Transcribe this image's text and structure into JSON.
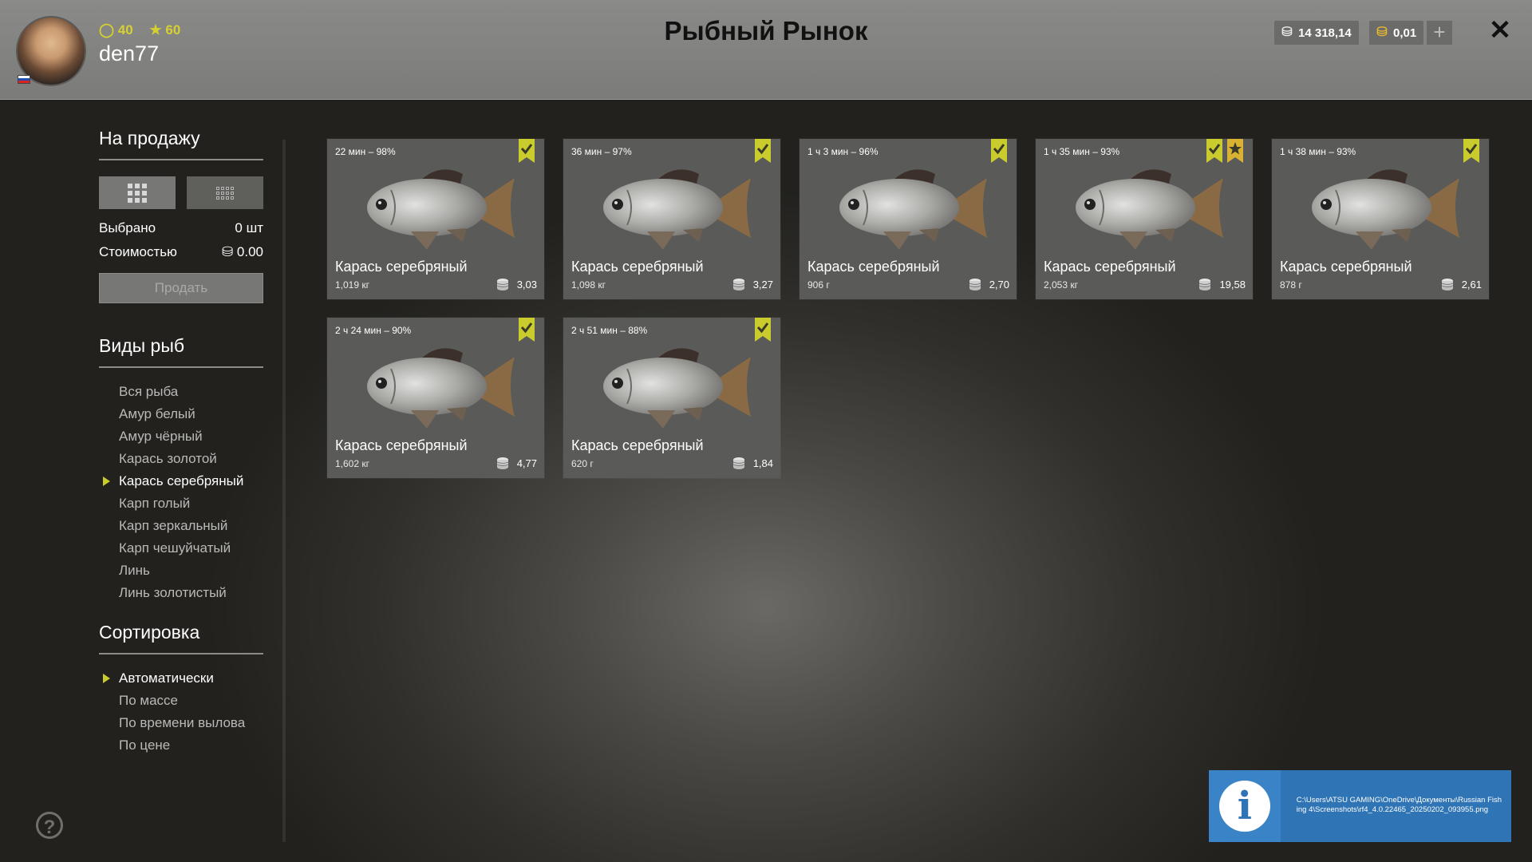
{
  "header": {
    "title": "Рыбный Рынок",
    "level": "40",
    "rank": "60",
    "username": "den77",
    "silver": "14 318,14",
    "gold": "0,01",
    "plus_label": "+",
    "close_label": "✕"
  },
  "sidebar": {
    "for_sale_title": "На продажу",
    "selected_label": "Выбрано",
    "selected_value": "0 шт",
    "cost_label": "Стоимостью",
    "cost_value": "0.00",
    "sell_button": "Продать",
    "species_title": "Виды рыб",
    "species": [
      {
        "label": "Вся рыба"
      },
      {
        "label": "Амур белый"
      },
      {
        "label": "Амур чёрный"
      },
      {
        "label": "Карась золотой"
      },
      {
        "label": "Карась серебряный",
        "active": true
      },
      {
        "label": "Карп голый"
      },
      {
        "label": "Карп зеркальный"
      },
      {
        "label": "Карп чешуйчатый"
      },
      {
        "label": "Линь"
      },
      {
        "label": "Линь золотистый"
      }
    ],
    "sort_title": "Сортировка",
    "sort": [
      {
        "label": "Автоматически",
        "active": true
      },
      {
        "label": "По массе"
      },
      {
        "label": "По времени вылова"
      },
      {
        "label": "По цене"
      }
    ]
  },
  "cards": [
    {
      "time": "22 мин – 98%",
      "name": "Карась серебряный",
      "weight": "1,019 кг",
      "price": "3,03",
      "star": false
    },
    {
      "time": "36 мин – 97%",
      "name": "Карась серебряный",
      "weight": "1,098 кг",
      "price": "3,27",
      "star": false
    },
    {
      "time": "1 ч 3 мин – 96%",
      "name": "Карась серебряный",
      "weight": "906 г",
      "price": "2,70",
      "star": false
    },
    {
      "time": "1 ч 35 мин – 93%",
      "name": "Карась серебряный",
      "weight": "2,053 кг",
      "price": "19,58",
      "star": true
    },
    {
      "time": "1 ч 38 мин – 93%",
      "name": "Карась серебряный",
      "weight": "878 г",
      "price": "2,61",
      "star": false
    },
    {
      "time": "2 ч 24 мин – 90%",
      "name": "Карась серебряный",
      "weight": "1,602 кг",
      "price": "4,77",
      "star": false
    },
    {
      "time": "2 ч 51 мин – 88%",
      "name": "Карась серебряный",
      "weight": "620 г",
      "price": "1,84",
      "star": false
    }
  ],
  "help_label": "?",
  "toast": {
    "icon": "i",
    "text": "C:\\Users\\ATSU GAMING\\OneDrive\\Документы\\Russian Fishing 4\\Screenshots\\rf4_4.0.22465_20250202_093955.png"
  },
  "colors": {
    "accent": "#c9cc2c",
    "toast": "#2f74b5"
  }
}
